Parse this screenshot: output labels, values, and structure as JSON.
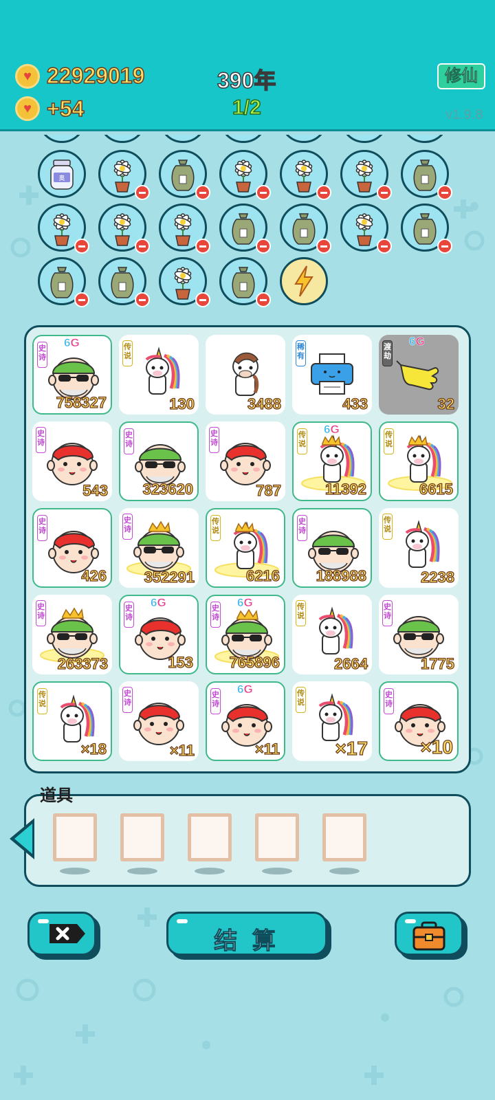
{
  "header": {
    "coins": "22929019",
    "income": "+54",
    "year": "390年",
    "round": "1/2",
    "mode_button": "修仙",
    "version": "v1.9.8"
  },
  "bubbles": [
    {
      "icon": "jar-icon",
      "label": "奥",
      "removable": false
    },
    {
      "icon": "flower-pot-icon",
      "removable": true
    },
    {
      "icon": "sack-icon",
      "removable": true
    },
    {
      "icon": "flower-pot-icon",
      "removable": true
    },
    {
      "icon": "flower-pot-icon",
      "removable": true
    },
    {
      "icon": "flower-pot-icon",
      "removable": true
    },
    {
      "icon": "sack-icon",
      "removable": true
    },
    {
      "icon": "flower-pot-icon",
      "removable": true
    },
    {
      "icon": "flower-pot-icon",
      "removable": true
    },
    {
      "icon": "flower-pot-icon",
      "removable": true
    },
    {
      "icon": "sack-icon",
      "removable": true
    },
    {
      "icon": "sack-icon",
      "removable": true
    },
    {
      "icon": "flower-pot-icon",
      "removable": true
    },
    {
      "icon": "sack-icon",
      "removable": true
    },
    {
      "icon": "sack-icon",
      "removable": true
    },
    {
      "icon": "sack-icon",
      "removable": true
    },
    {
      "icon": "flower-pot-icon",
      "removable": true
    },
    {
      "icon": "sack-icon",
      "removable": true
    },
    {
      "icon": "lightning-icon",
      "removable": false
    }
  ],
  "board": [
    {
      "char": "man-green",
      "tag": "史诗",
      "tier": "epic",
      "g6": true,
      "value": "758327",
      "hl": true
    },
    {
      "char": "unicorn",
      "tag": "传说",
      "tier": "leg",
      "value": "130"
    },
    {
      "char": "horse",
      "value": "3488"
    },
    {
      "char": "printer",
      "tag": "稀有",
      "tier": "rare",
      "value": "433"
    },
    {
      "char": "hand",
      "tag": "渡劫",
      "tier": "dark",
      "g6": true,
      "value": "32",
      "grey": true
    },
    {
      "char": "man-red",
      "tag": "史诗",
      "tier": "epic",
      "value": "543"
    },
    {
      "char": "man-green",
      "tag": "史诗",
      "tier": "epic",
      "value": "323620",
      "hl": true
    },
    {
      "char": "man-red",
      "tag": "史诗",
      "tier": "epic",
      "value": "787"
    },
    {
      "char": "unicorn",
      "tag": "传说",
      "tier": "leg",
      "g6": true,
      "crown": true,
      "aura": true,
      "value": "11392",
      "hl": true
    },
    {
      "char": "unicorn",
      "tag": "传说",
      "tier": "leg",
      "crown": true,
      "aura": true,
      "value": "6615",
      "hl": true
    },
    {
      "char": "man-red",
      "tag": "史诗",
      "tier": "epic",
      "value": "426",
      "hl": true
    },
    {
      "char": "man-green",
      "tag": "史诗",
      "tier": "epic",
      "crown": true,
      "aura": true,
      "value": "352291"
    },
    {
      "char": "unicorn",
      "tag": "传说",
      "tier": "leg",
      "crown": true,
      "aura": true,
      "value": "6216",
      "hl": true
    },
    {
      "char": "man-green",
      "tag": "史诗",
      "tier": "epic",
      "value": "188988",
      "hl": true
    },
    {
      "char": "unicorn",
      "tag": "传说",
      "tier": "leg",
      "value": "2238"
    },
    {
      "char": "man-green",
      "tag": "史诗",
      "tier": "epic",
      "crown": true,
      "aura": true,
      "value": "263373"
    },
    {
      "char": "man-red",
      "tag": "史诗",
      "tier": "epic",
      "g6": true,
      "value": "153",
      "hl": true
    },
    {
      "char": "man-green",
      "tag": "史诗",
      "tier": "epic",
      "g6": true,
      "crown": true,
      "aura": true,
      "value": "765896",
      "hl": true
    },
    {
      "char": "unicorn",
      "tag": "传说",
      "tier": "leg",
      "value": "2664"
    },
    {
      "char": "man-green",
      "tag": "史诗",
      "tier": "epic",
      "value": "1775"
    },
    {
      "char": "unicorn",
      "tag": "传说",
      "tier": "leg",
      "value": "×18",
      "hl": true
    },
    {
      "char": "man-red",
      "tag": "史诗",
      "tier": "epic",
      "value": "×11"
    },
    {
      "char": "man-red",
      "tag": "史诗",
      "tier": "epic",
      "g6": true,
      "value": "×11",
      "hl": true
    },
    {
      "char": "unicorn",
      "tag": "传说",
      "tier": "leg",
      "value": "×17",
      "big": true
    },
    {
      "char": "man-red",
      "tag": "史诗",
      "tier": "epic",
      "value": "×10",
      "big": true,
      "hl": true
    }
  ],
  "tools": {
    "label": "道具",
    "slots": 5
  },
  "buttons": {
    "close_icon": "close-icon",
    "settle_label": "结 算",
    "bag_icon": "briefcase-icon"
  },
  "g6_text": {
    "num": "6",
    "letter": "G"
  }
}
